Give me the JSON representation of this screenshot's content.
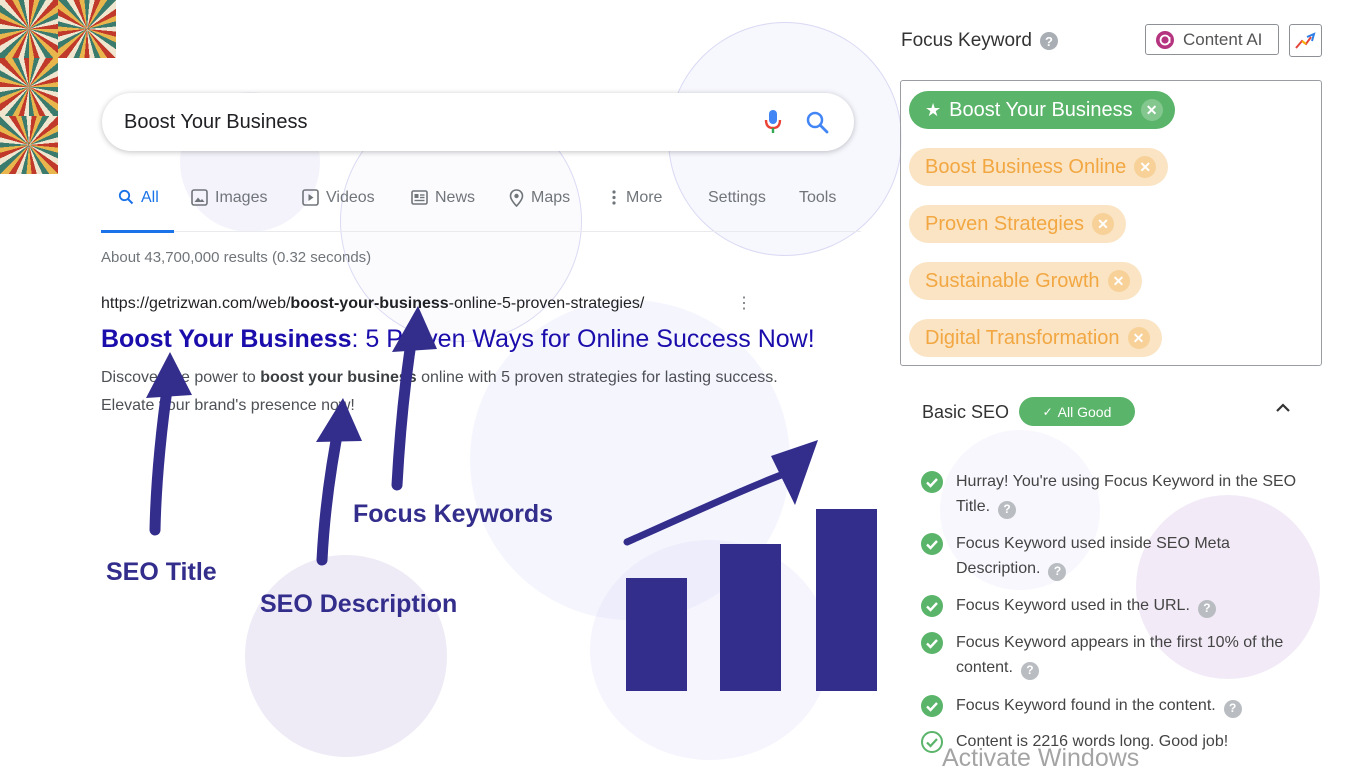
{
  "colors": {
    "accent_blue": "#1a73e8",
    "link_title": "#1a0dab",
    "annotation_navy": "#332d8c",
    "good_green": "#5ab46a",
    "keyword_orange": "#f2a742",
    "bar_navy": "#332d8c"
  },
  "search": {
    "query": "Boost Your Business",
    "icons": [
      "mic-icon",
      "search-icon"
    ]
  },
  "tabs": [
    {
      "label": "All",
      "icon": "search-icon",
      "active": true
    },
    {
      "label": "Images",
      "icon": "image-icon"
    },
    {
      "label": "Videos",
      "icon": "video-icon"
    },
    {
      "label": "News",
      "icon": "news-icon"
    },
    {
      "label": "Maps",
      "icon": "map-pin-icon"
    },
    {
      "label": "More",
      "icon": "more-vertical-icon"
    },
    {
      "label": "Settings"
    },
    {
      "label": "Tools"
    }
  ],
  "result_stats": "About 43,700,000 results (0.32 seconds)",
  "result": {
    "url_prefix": "https://getrizwan.com/web/",
    "url_keyword": "boost-your-business",
    "url_suffix": "-online-5-proven-strategies/",
    "title_keyword": "Boost Your Business",
    "title_rest": ": 5 Proven Ways for Online Success Now!",
    "snippet_1": "Discover the power to ",
    "snippet_keyword": "boost your business",
    "snippet_2": " online with 5 proven strategies for lasting success. Elevate your brand's presence now!"
  },
  "annotations": {
    "seo_title": "SEO Title",
    "seo_description": "SEO Description",
    "focus_keywords": "Focus Keywords"
  },
  "illustration": {
    "bar_levels": [
      0.62,
      0.81,
      1.0
    ]
  },
  "panel": {
    "focus_keyword_label": "Focus Keyword",
    "content_ai_label": "Content AI",
    "keywords": [
      {
        "label": "Boost Your Business",
        "primary": true
      },
      {
        "label": "Boost Business Online",
        "primary": false
      },
      {
        "label": "Proven Strategies",
        "primary": false
      },
      {
        "label": "Sustainable Growth",
        "primary": false
      },
      {
        "label": "Digital Transformation",
        "primary": false
      }
    ],
    "basic_seo_label": "Basic SEO",
    "status_badge": "All Good",
    "checks": [
      {
        "text": "Hurray! You're using Focus Keyword in the SEO Title."
      },
      {
        "text": "Focus Keyword used inside SEO Meta Description."
      },
      {
        "text": "Focus Keyword used in the URL."
      },
      {
        "text": "Focus Keyword appears in the first 10% of the content."
      },
      {
        "text": "Focus Keyword found in the content."
      },
      {
        "text": "Content is 2216 words long. Good job!"
      }
    ]
  },
  "watermark": "Activate Windows"
}
